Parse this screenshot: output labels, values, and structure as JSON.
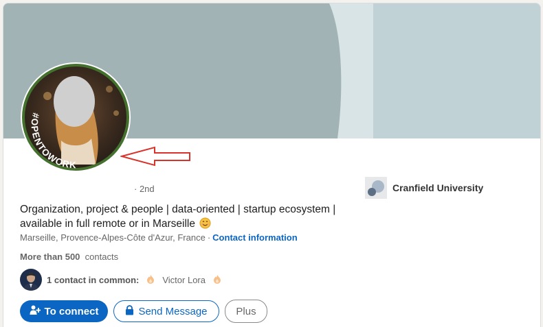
{
  "profile": {
    "open_to_work_badge": "#OPENTOWORK",
    "degree": "· 2nd",
    "headline": "Organization, project & people | data-oriented | startup ecosystem | available in full remote or in Marseille",
    "location": "Marseille, Provence-Alpes-Côte d'Azur, France",
    "location_separator": "·",
    "contact_info_label": "Contact information",
    "contacts_count": "More than 500",
    "contacts_label": "contacts",
    "mutual_label": "1 contact in common:",
    "mutual_name": "Victor Lora"
  },
  "education": {
    "school_name": "Cranfield University"
  },
  "actions": {
    "connect_label": "To connect",
    "message_label": "Send Message",
    "more_label": "Plus"
  },
  "colors": {
    "accent": "#0a66c2",
    "open_to_work_green": "#44712e",
    "arrow_red": "#d9322a",
    "cover_dark": "#a2b3b6",
    "cover_light": "#bfd2d6"
  },
  "icons": {
    "smile": "smiling-face-icon",
    "fire": "fire-icon",
    "add_person": "add-person-icon",
    "lock": "lock-icon"
  }
}
